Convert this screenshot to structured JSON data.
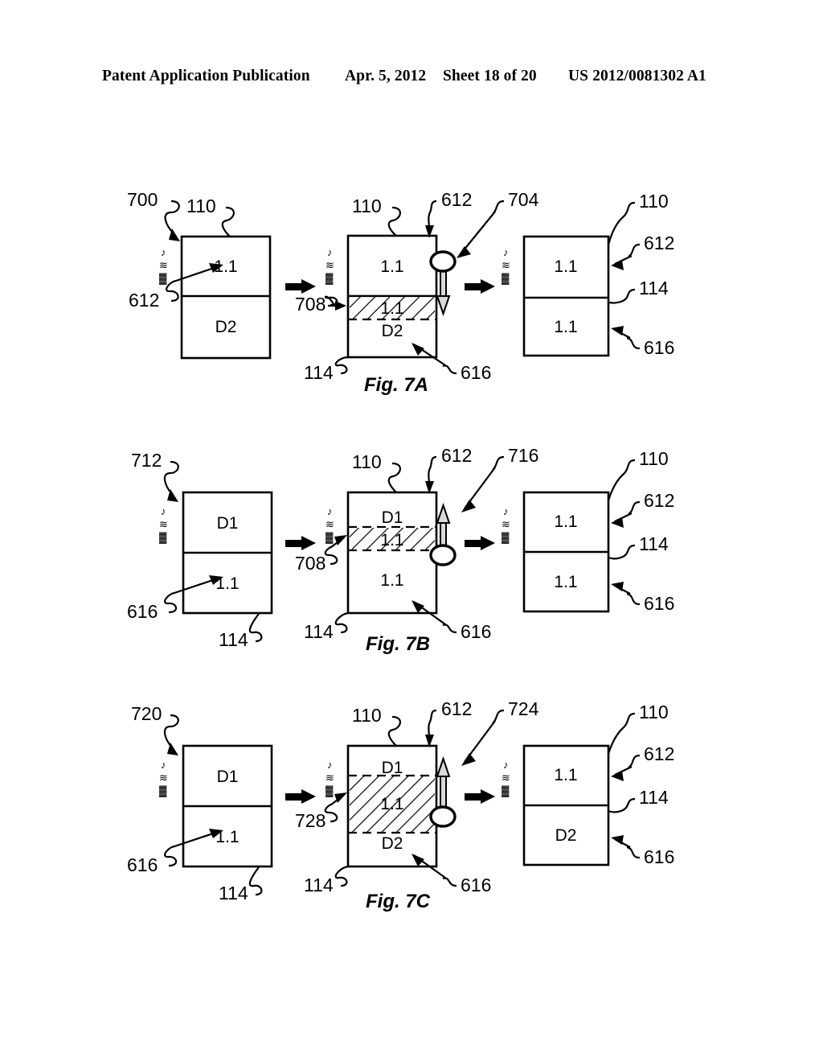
{
  "header": {
    "publication": "Patent Application Publication",
    "date": "Apr. 5, 2012",
    "sheet": "Sheet 18 of 20",
    "docnum": "US 2012/0081302 A1"
  },
  "figures": [
    {
      "id": "fig-7a",
      "caption": "Fig. 7A",
      "system_ref": "700",
      "panels": [
        {
          "name": "left",
          "box_top_label": "1.1",
          "box_bottom_label": "D2",
          "refs": [
            "110",
            "612"
          ]
        },
        {
          "name": "middle",
          "box_top_label": "1.1",
          "hatch_label": "1.1",
          "hatch_below_label": "D2",
          "refs": [
            "110",
            "612",
            "708",
            "114",
            "616"
          ],
          "indicator_ref": "704",
          "indicator_direction": "down"
        },
        {
          "name": "right",
          "box_top_label": "1.1",
          "box_bottom_label": "1.1",
          "refs": [
            "110",
            "612",
            "114",
            "616"
          ]
        }
      ]
    },
    {
      "id": "fig-7b",
      "caption": "Fig. 7B",
      "system_ref": "712",
      "panels": [
        {
          "name": "left",
          "box_top_label": "D1",
          "box_bottom_label": "1.1",
          "refs": [
            "616",
            "114"
          ]
        },
        {
          "name": "middle",
          "box_top_label": "D1",
          "hatch_label": "1.1",
          "box_bottom_label": "1.1",
          "refs": [
            "110",
            "612",
            "708",
            "114",
            "616"
          ],
          "indicator_ref": "716",
          "indicator_direction": "up"
        },
        {
          "name": "right",
          "box_top_label": "1.1",
          "box_bottom_label": "1.1",
          "refs": [
            "110",
            "612",
            "114",
            "616"
          ]
        }
      ]
    },
    {
      "id": "fig-7c",
      "caption": "Fig. 7C",
      "system_ref": "720",
      "panels": [
        {
          "name": "left",
          "box_top_label": "D1",
          "box_bottom_label": "1.1",
          "refs": [
            "616",
            "114"
          ]
        },
        {
          "name": "middle",
          "hatch_top_label": "D1",
          "hatch_label": "1.1",
          "hatch_bottom_label": "D2",
          "refs": [
            "110",
            "612",
            "728",
            "114",
            "616"
          ],
          "indicator_ref": "724",
          "indicator_direction": "up"
        },
        {
          "name": "right",
          "box_top_label": "1.1",
          "box_bottom_label": "D2",
          "refs": [
            "110",
            "612",
            "114",
            "616"
          ]
        }
      ]
    }
  ],
  "labels": {
    "r110": "110",
    "r114": "114",
    "r612": "612",
    "r616": "616",
    "r700": "700",
    "r704": "704",
    "r708": "708",
    "r712": "712",
    "r716": "716",
    "r720": "720",
    "r724": "724",
    "r728": "728",
    "d1": "D1",
    "d2": "D2",
    "one_one": "1.1"
  },
  "glyph_marks": [
    "♪",
    "≋",
    "▓"
  ]
}
